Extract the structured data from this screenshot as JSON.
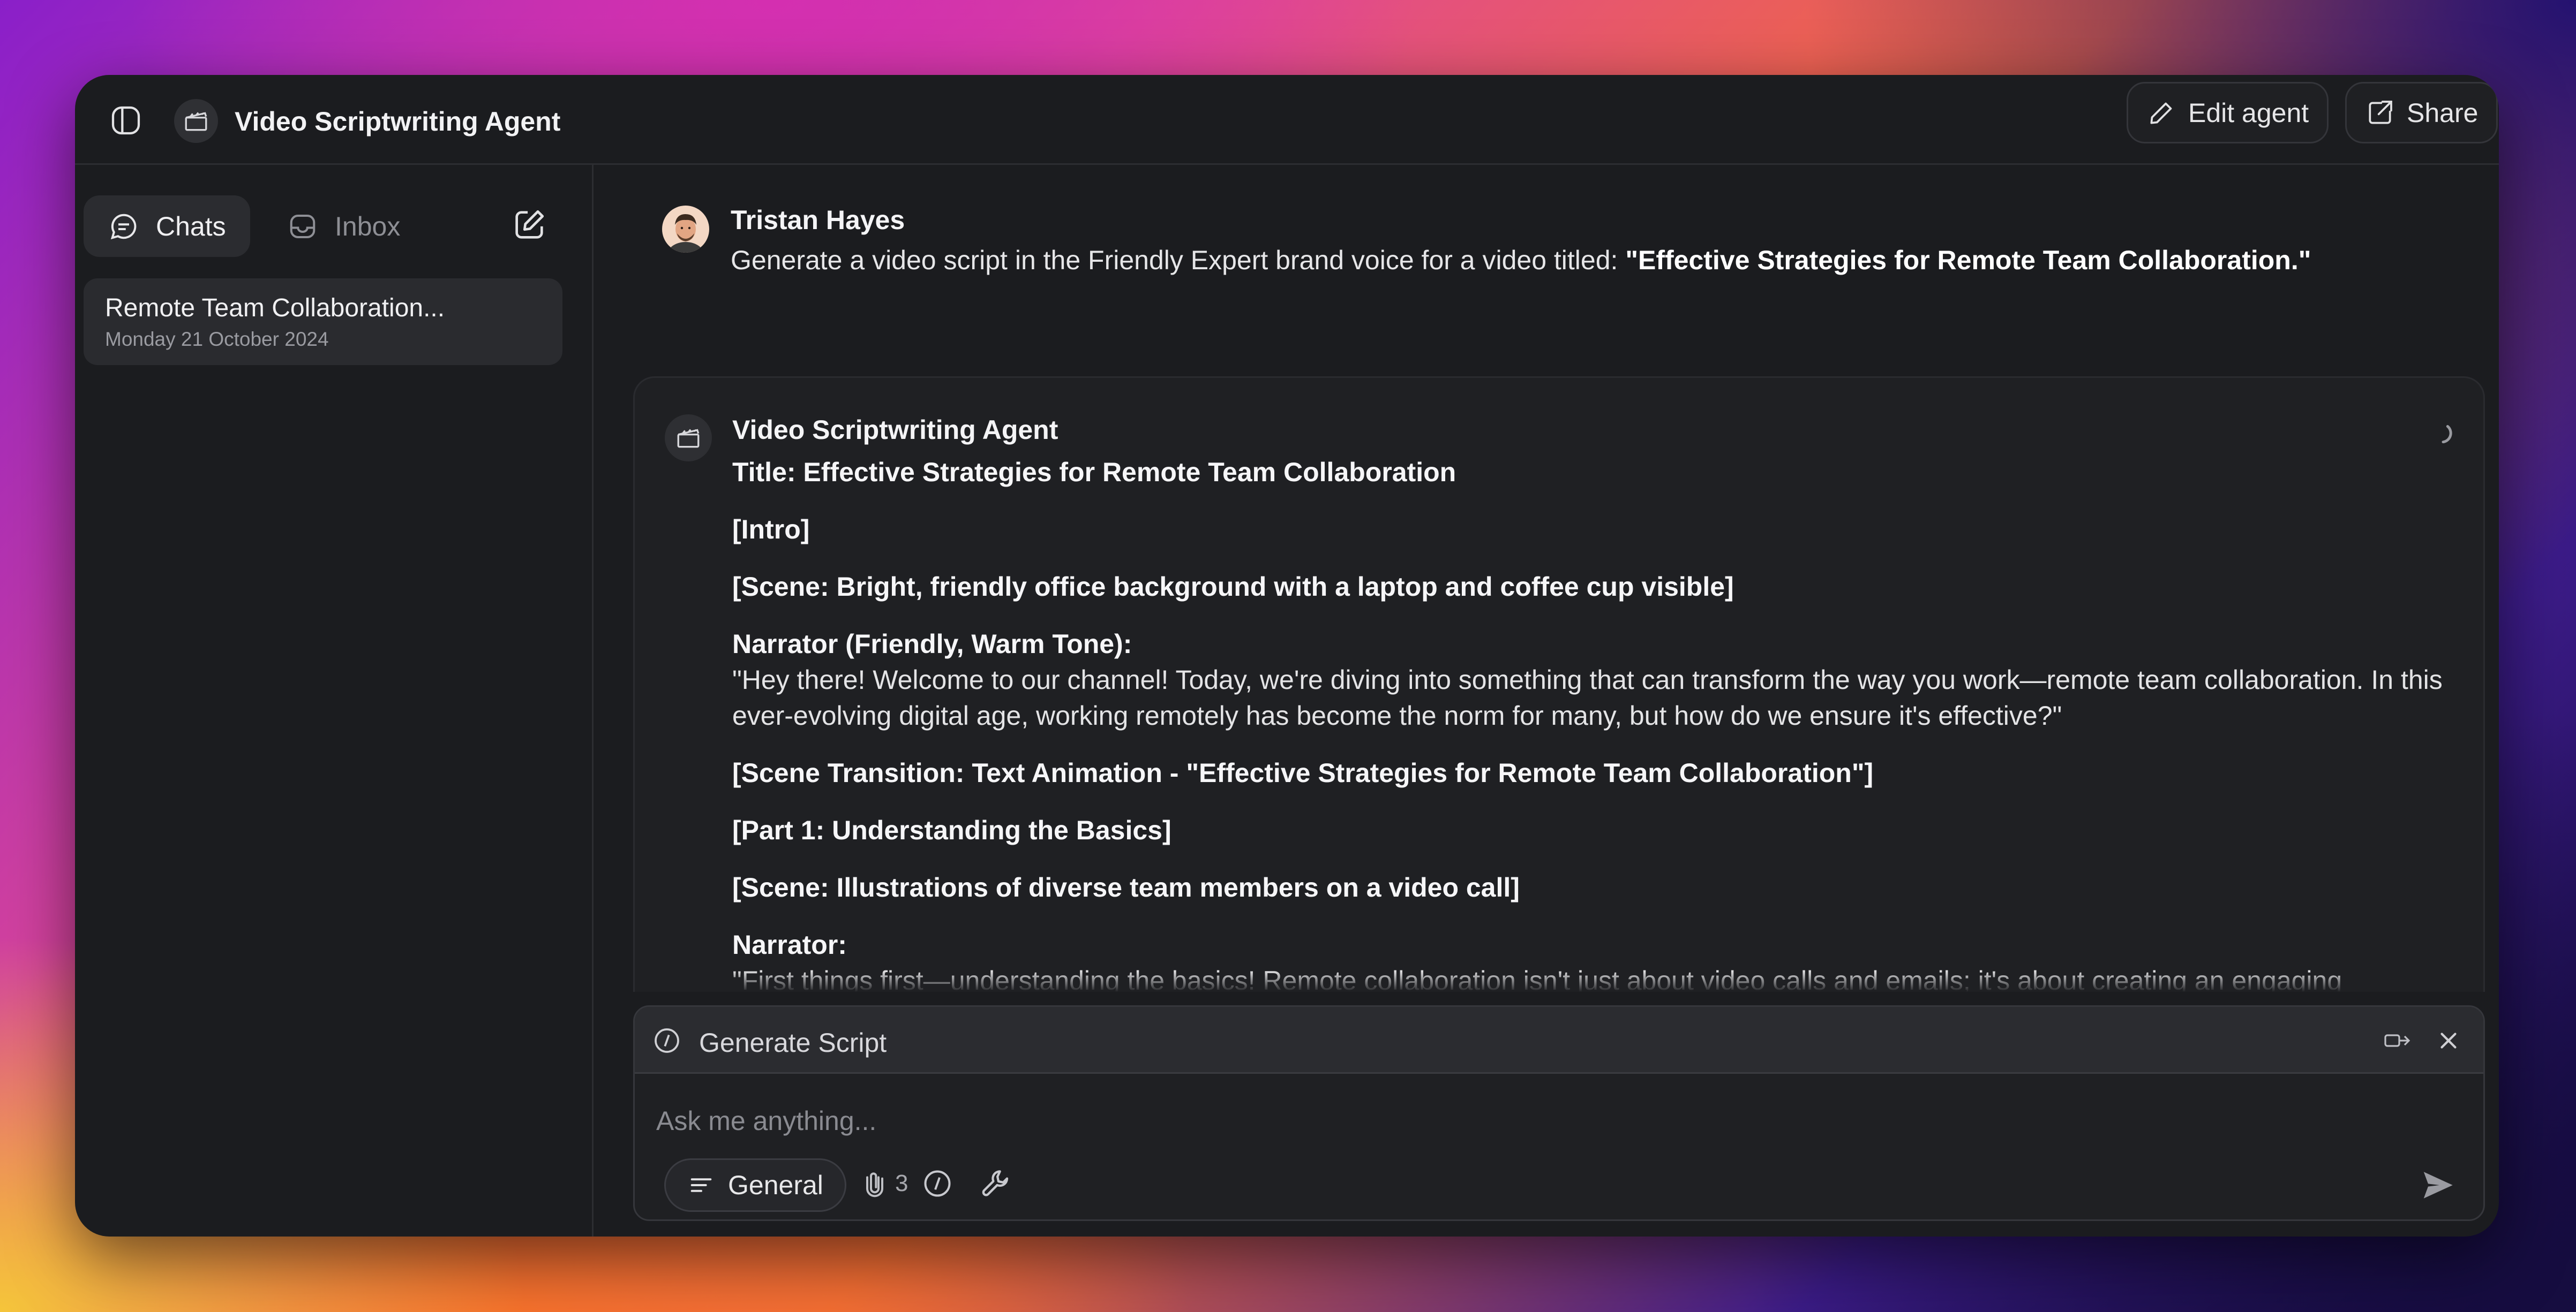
{
  "window": {
    "title": "Video Scriptwriting Agent",
    "edit_agent_label": "Edit agent",
    "share_label": "Share"
  },
  "sidebar": {
    "tabs": [
      {
        "label": "Chats",
        "icon": "chat-bubble-icon",
        "active": true
      },
      {
        "label": "Inbox",
        "icon": "inbox-tray-icon",
        "active": false
      }
    ],
    "chats": [
      {
        "title": "Remote Team Collaboration...",
        "date": "Monday 21 October 2024"
      }
    ]
  },
  "conversation": {
    "user_message": {
      "author": "Tristan Hayes",
      "text_prefix": "Generate a video script in the Friendly Expert brand voice for a video titled: ",
      "text_bold": "\"Effective Strategies for Remote Team Collaboration.\""
    },
    "agent_message": {
      "author": "Video Scriptwriting Agent",
      "lines": [
        {
          "text": "Title: Effective Strategies for Remote Team Collaboration",
          "bold": true
        },
        {
          "text": "[Intro]",
          "bold": true
        },
        {
          "text": "[Scene: Bright, friendly office background with a laptop and coffee cup visible]",
          "bold": true
        },
        {
          "text": "Narrator (Friendly, Warm Tone):",
          "bold": true,
          "attached_next": true
        },
        {
          "text": "\"Hey there! Welcome to our channel! Today, we're diving into something that can transform the way you work—remote team collaboration. In this ever-evolving digital age, working remotely has become the norm for many, but how do we ensure it's effective?\"",
          "bold": false
        },
        {
          "text": "[Scene Transition: Text Animation - \"Effective Strategies for Remote Team Collaboration\"]",
          "bold": true
        },
        {
          "text": "[Part 1: Understanding the Basics]",
          "bold": true
        },
        {
          "text": "[Scene: Illustrations of diverse team members on a video call]",
          "bold": true
        },
        {
          "text": "Narrator:",
          "bold": true,
          "attached_next": true
        },
        {
          "text": "\"First things first—understanding the basics! Remote collaboration isn't just about video calls and emails; it's about creating an engaging",
          "bold": false
        }
      ]
    }
  },
  "composer": {
    "command_label": "Generate Script",
    "placeholder": "Ask me anything...",
    "mode_label": "General",
    "attachment_count": "3"
  },
  "colors": {
    "window_bg": "#1b1c1f",
    "card_bg": "#1f2023",
    "accent_text": "#f4f4f6",
    "muted_text": "#8e8f95"
  }
}
